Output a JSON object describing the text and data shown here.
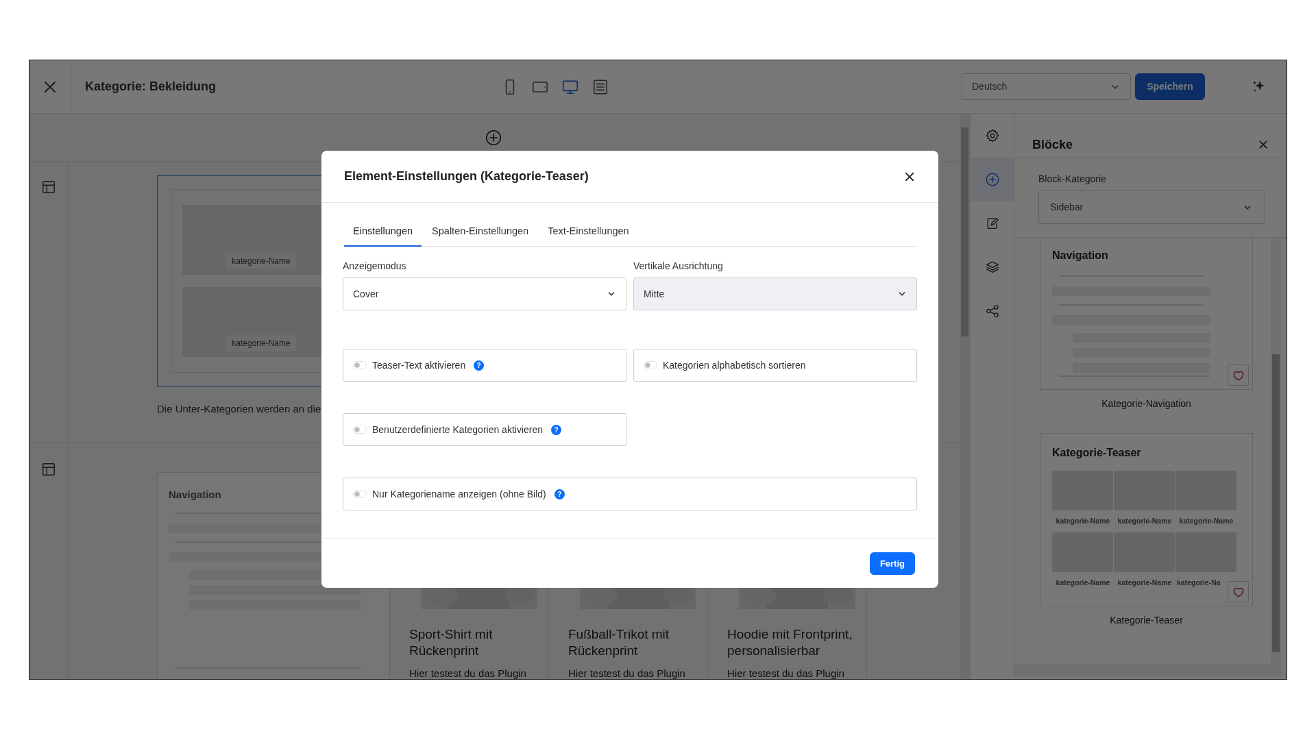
{
  "header": {
    "title": "Kategorie: Bekleidung",
    "device_views": [
      {
        "selected": false
      },
      {
        "selected": false
      },
      {
        "selected": true
      },
      {
        "selected": false
      }
    ],
    "language": "Deutsch",
    "save_button": "Speichern"
  },
  "canvas": {
    "section_1": {
      "tiles": [
        "kategorie-Name",
        "kategorie-Name"
      ],
      "note": "Die Unter-Kategorien werden an die"
    },
    "section_2": {
      "navigation_title": "Navigation",
      "products": [
        {
          "title_lines": [
            "Sport-Shirt mit",
            "Rückenprint"
          ],
          "description": "Hier testest du das Plugin"
        },
        {
          "title_lines": [
            "Fußball-Trikot mit",
            "Rückenprint"
          ],
          "description": "Hier testest du das Plugin"
        },
        {
          "title_lines": [
            "Hoodie mit Frontprint,",
            "personalisierbar"
          ],
          "description": "Hier testest du das Plugin"
        }
      ]
    }
  },
  "tool_rail": [
    {
      "selected": false
    },
    {
      "selected": true
    },
    {
      "selected": false
    },
    {
      "selected": false
    },
    {
      "selected": false
    }
  ],
  "blocks_panel": {
    "title": "Blöcke",
    "category_label": "Block-Kategorie",
    "category": "Sidebar",
    "blocks": [
      {
        "kind": "navigation",
        "title": "Navigation",
        "caption": "Kategorie-Navigation"
      },
      {
        "kind": "teaser",
        "title": "Kategorie-Teaser",
        "tiles": [
          "kategorie-Name",
          "kategorie-Name",
          "kategorie-Name",
          "kategorie-Name",
          "kategorie-Name",
          "kategorie-Na"
        ],
        "caption": "Kategorie-Teaser"
      }
    ]
  },
  "modal": {
    "title": "Element-Einstellungen (Kategorie-Teaser)",
    "tabs": [
      {
        "label": "Einstellungen",
        "selected": true
      },
      {
        "label": "Spalten-Einstellungen",
        "selected": false
      },
      {
        "label": "Text-Einstellungen",
        "selected": false
      }
    ],
    "fields": [
      {
        "label": "Anzeigemodus",
        "value": "Cover",
        "disabled": false
      },
      {
        "label": "Vertikale Ausrichtung",
        "value": "Mitte",
        "disabled": true
      }
    ],
    "toggle_rows": [
      {
        "kind": "half",
        "toggles": [
          {
            "label": "Teaser-Text aktivieren",
            "on": false,
            "help": "?"
          },
          {
            "label": "Kategorien alphabetisch sortieren",
            "on": false
          }
        ]
      },
      {
        "kind": "half",
        "toggles": [
          {
            "label": "Benutzerdefinierte Kategorien aktivieren",
            "on": false,
            "help": "?"
          }
        ]
      },
      {
        "kind": "full",
        "toggles": [
          {
            "label": "Nur Kategoriename anzeigen (ohne Bild)",
            "on": false,
            "help": "?"
          }
        ]
      }
    ],
    "done_button": "Fertig"
  }
}
